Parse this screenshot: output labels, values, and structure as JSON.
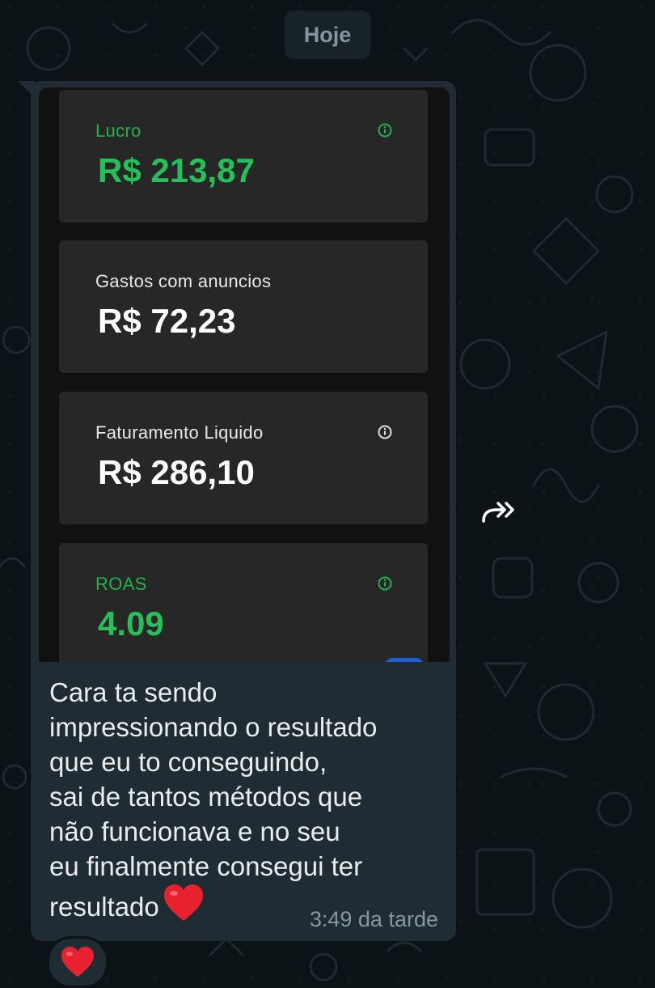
{
  "chat": {
    "date_chip": "Hoje",
    "message": {
      "cards": [
        {
          "label": "Lucro",
          "value": "R$ 213,87",
          "accent": "green",
          "info_icon": "info-icon"
        },
        {
          "label": "Gastos com anuncios",
          "value": "R$ 72,23",
          "accent": "white",
          "info_icon": null
        },
        {
          "label": "Faturamento Liquido",
          "value": "R$ 286,10",
          "accent": "white",
          "info_icon": "info-icon"
        },
        {
          "label": "ROAS",
          "value": "4.09",
          "accent": "green",
          "info_icon": "info-icon"
        }
      ],
      "text": "Cara ta sendo\nimpressionando o resultado\nque eu to conseguindo,\nsai de tantos métodos que\nnão funcionava e no seu\neu finalmente consegui ter\nresultado",
      "emoji": "heart-emoji",
      "time": "3:49 da tarde"
    },
    "reaction": "heart-emoji",
    "forward_icon": "forward-icon"
  },
  "colors": {
    "background": "#0c1317",
    "bubble": "#1f2c34",
    "card": "#272727",
    "green_accent": "#25c05a",
    "text": "#e9edef",
    "meta_text": "#8696a0"
  }
}
